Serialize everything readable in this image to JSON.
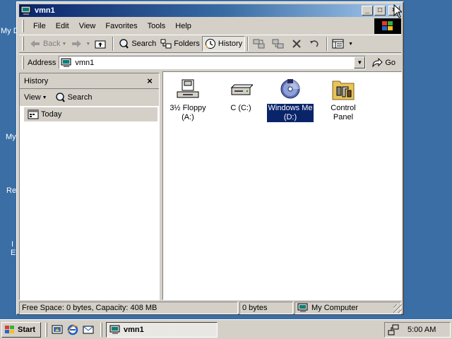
{
  "desktop": {
    "label_fragments": [
      "My D",
      "My",
      "Re",
      "I",
      "E"
    ]
  },
  "window": {
    "title": "vmn1",
    "caption_buttons": {
      "minimize": "_",
      "maximize": "□",
      "close": "×"
    }
  },
  "menubar": {
    "items": [
      "File",
      "Edit",
      "View",
      "Favorites",
      "Tools",
      "Help"
    ]
  },
  "toolbar": {
    "back_label": "Back",
    "search_label": "Search",
    "folders_label": "Folders",
    "history_label": "History"
  },
  "address": {
    "label": "Address",
    "value": "vmn1",
    "go_label": "Go"
  },
  "history_pane": {
    "title": "History",
    "view_label": "View",
    "search_label": "Search",
    "items": [
      "Today"
    ]
  },
  "drives": [
    {
      "label_line1": "3½ Floppy",
      "label_line2": "(A:)",
      "icon": "floppy-drive-icon",
      "selected": false
    },
    {
      "label_line1": "C (C:)",
      "label_line2": "",
      "icon": "hard-drive-icon",
      "selected": false
    },
    {
      "label_line1": "Windows Me",
      "label_line2": "(D:)",
      "icon": "cd-drive-icon",
      "selected": true
    },
    {
      "label_line1": "Control Panel",
      "label_line2": "",
      "icon": "control-panel-icon",
      "selected": false
    }
  ],
  "statusbar": {
    "free_space": "Free Space: 0 bytes, Capacity: 408 MB",
    "size": "0 bytes",
    "zone": "My Computer"
  },
  "taskbar": {
    "start_label": "Start",
    "task_label": "vmn1",
    "clock": "5:00 AM"
  },
  "colors": {
    "desktop": "#3a6ea5",
    "titlebar_start": "#0a246a",
    "titlebar_end": "#a6caf0",
    "face": "#d4d0c8",
    "selection": "#0a246a"
  }
}
